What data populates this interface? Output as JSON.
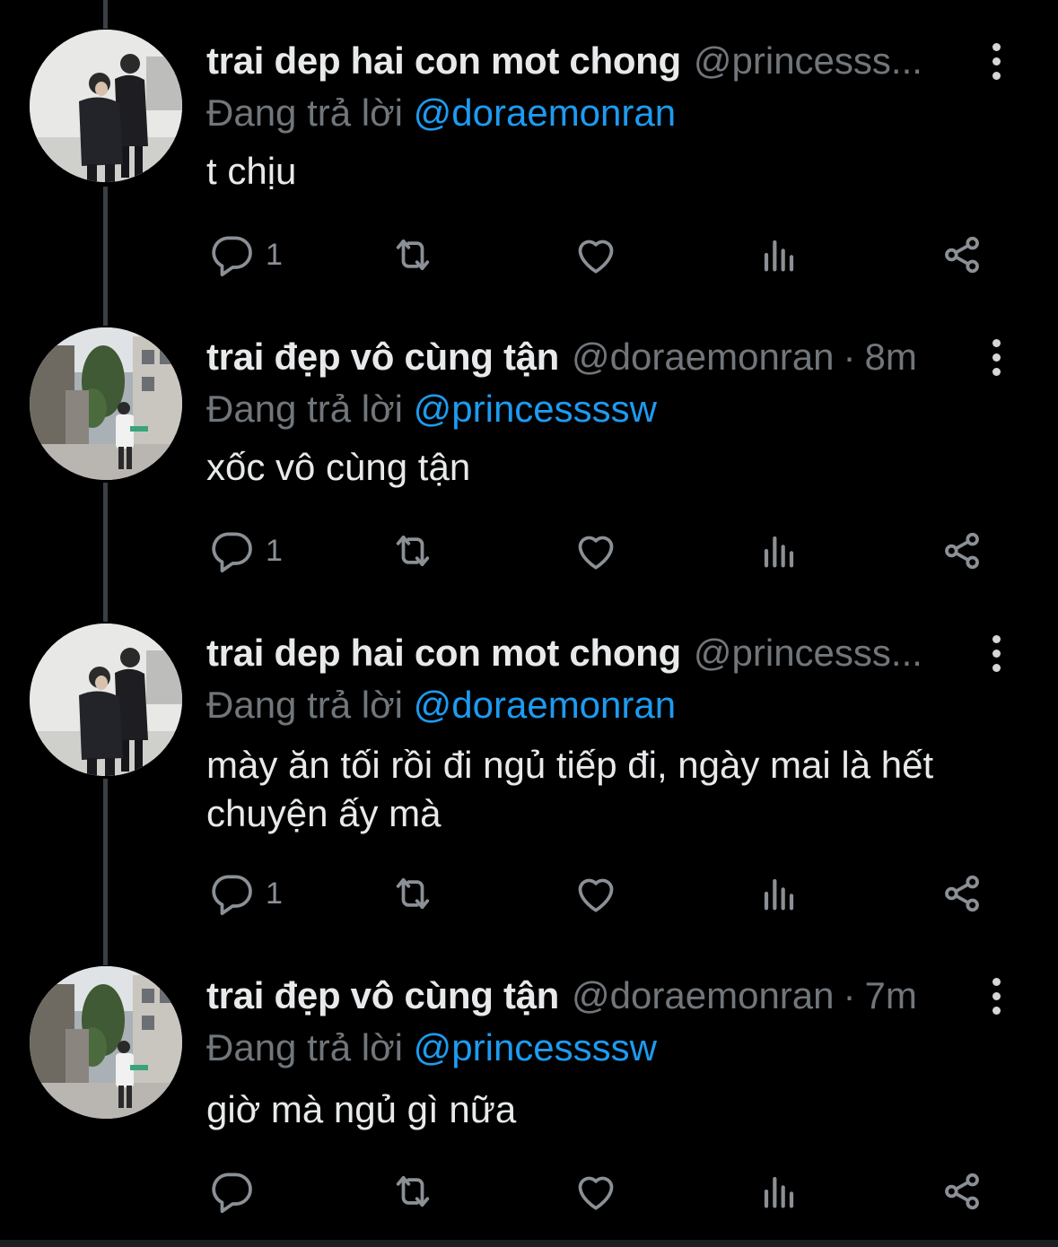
{
  "colors": {
    "background": "#000000",
    "text_primary": "#e7e9ea",
    "text_secondary": "#71767b",
    "mention_blue": "#1d9bf0",
    "icon_gray": "#8b9096",
    "thread_line": "#3a3f44"
  },
  "tweets": [
    {
      "name": "trai dep hai con mot chong",
      "handle": "@princesss...",
      "sep": "",
      "time": "",
      "reply_prefix": "Đang trả lời",
      "reply_to": "@doraemonran",
      "text": "t chịu",
      "reply_count": "1",
      "avatar_icon": "profile-photo-two-men-in-suits"
    },
    {
      "name": "trai đẹp vô cùng tận",
      "handle": "@doraemonran",
      "sep": "·",
      "time": "8m",
      "reply_prefix": "Đang trả lời",
      "reply_to": "@princessssw",
      "text": "xốc vô cùng tận",
      "reply_count": "1",
      "avatar_icon": "profile-photo-street-person"
    },
    {
      "name": "trai dep hai con mot chong",
      "handle": "@princesss...",
      "sep": "",
      "time": "",
      "reply_prefix": "Đang trả lời",
      "reply_to": "@doraemonran",
      "text": "mày ăn tối rồi đi ngủ tiếp đi, ngày mai là hết chuyện ấy mà",
      "reply_count": "1",
      "avatar_icon": "profile-photo-two-men-in-suits"
    },
    {
      "name": "trai đẹp vô cùng tận",
      "handle": "@doraemonran",
      "sep": "·",
      "time": "7m",
      "reply_prefix": "Đang trả lời",
      "reply_to": "@princessssw",
      "text": "giờ mà ngủ gì nữa",
      "reply_count": "",
      "avatar_icon": "profile-photo-street-person"
    }
  ]
}
